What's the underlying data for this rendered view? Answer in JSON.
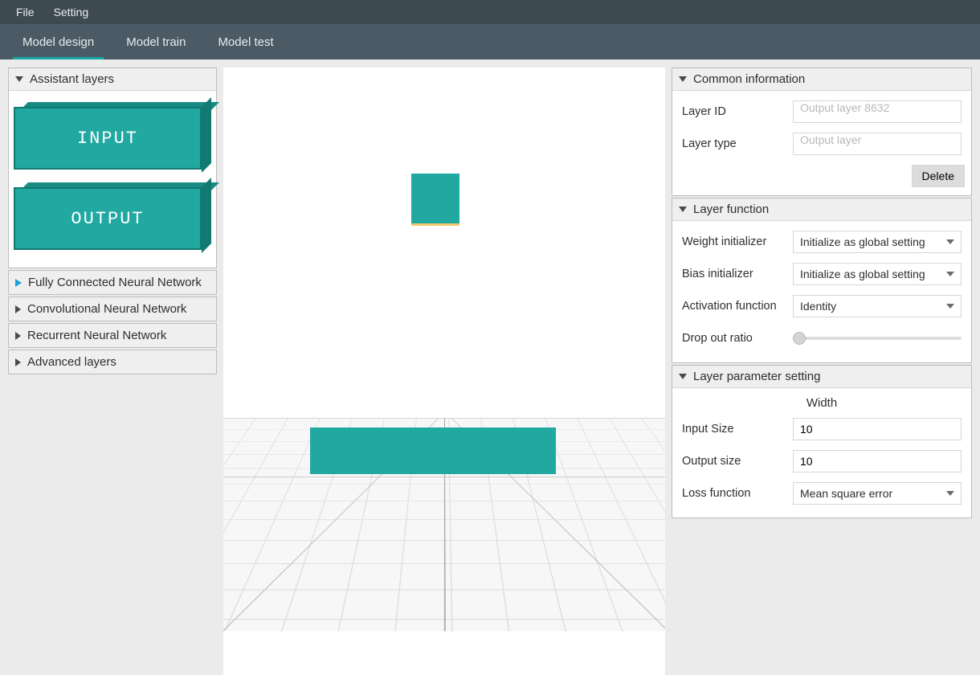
{
  "menu": {
    "file": "File",
    "setting": "Setting"
  },
  "tabs": {
    "design": "Model design",
    "train": "Model train",
    "test": "Model test"
  },
  "leftPanel": {
    "assistantTitle": "Assistant layers",
    "inputBlock": "INPUT",
    "outputBlock": "OUTPUT",
    "groups": {
      "fcnn": "Fully Connected Neural Network",
      "cnn": "Convolutional Neural Network",
      "rnn": "Recurrent Neural Network",
      "adv": "Advanced layers"
    }
  },
  "inspector": {
    "common": {
      "title": "Common information",
      "layerIdLabel": "Layer ID",
      "layerIdValue": "Output layer 8632",
      "layerTypeLabel": "Layer type",
      "layerTypeValue": "Output layer",
      "deleteLabel": "Delete"
    },
    "func": {
      "title": "Layer function",
      "weightInitLabel": "Weight initializer",
      "weightInitValue": "Initialize as global setting",
      "biasInitLabel": "Bias initializer",
      "biasInitValue": "Initialize as global setting",
      "activationLabel": "Activation function",
      "activationValue": "Identity",
      "dropoutLabel": "Drop out ratio"
    },
    "param": {
      "title": "Layer parameter setting",
      "widthHeader": "Width",
      "inputSizeLabel": "Input Size",
      "inputSizeValue": "10",
      "outputSizeLabel": "Output size",
      "outputSizeValue": "10",
      "lossLabel": "Loss function",
      "lossValue": "Mean square error"
    }
  }
}
